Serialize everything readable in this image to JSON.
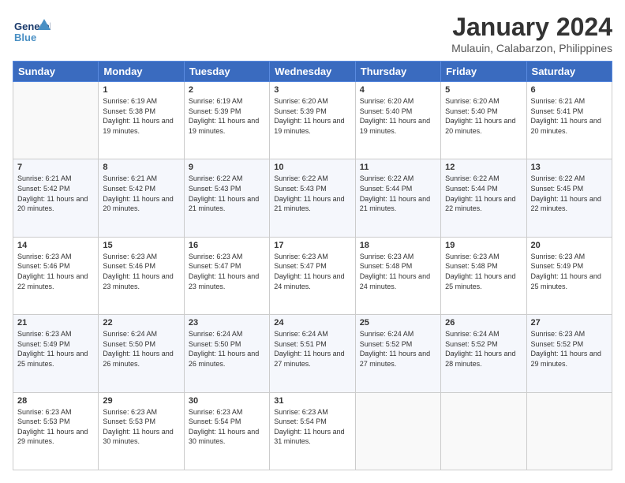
{
  "header": {
    "logo_line1": "General",
    "logo_line2": "Blue",
    "title": "January 2024",
    "subtitle": "Mulauin, Calabarzon, Philippines"
  },
  "days_of_week": [
    "Sunday",
    "Monday",
    "Tuesday",
    "Wednesday",
    "Thursday",
    "Friday",
    "Saturday"
  ],
  "weeks": [
    [
      {
        "day": "",
        "sunrise": "",
        "sunset": "",
        "daylight": ""
      },
      {
        "day": "1",
        "sunrise": "Sunrise: 6:19 AM",
        "sunset": "Sunset: 5:38 PM",
        "daylight": "Daylight: 11 hours and 19 minutes."
      },
      {
        "day": "2",
        "sunrise": "Sunrise: 6:19 AM",
        "sunset": "Sunset: 5:39 PM",
        "daylight": "Daylight: 11 hours and 19 minutes."
      },
      {
        "day": "3",
        "sunrise": "Sunrise: 6:20 AM",
        "sunset": "Sunset: 5:39 PM",
        "daylight": "Daylight: 11 hours and 19 minutes."
      },
      {
        "day": "4",
        "sunrise": "Sunrise: 6:20 AM",
        "sunset": "Sunset: 5:40 PM",
        "daylight": "Daylight: 11 hours and 19 minutes."
      },
      {
        "day": "5",
        "sunrise": "Sunrise: 6:20 AM",
        "sunset": "Sunset: 5:40 PM",
        "daylight": "Daylight: 11 hours and 20 minutes."
      },
      {
        "day": "6",
        "sunrise": "Sunrise: 6:21 AM",
        "sunset": "Sunset: 5:41 PM",
        "daylight": "Daylight: 11 hours and 20 minutes."
      }
    ],
    [
      {
        "day": "7",
        "sunrise": "Sunrise: 6:21 AM",
        "sunset": "Sunset: 5:42 PM",
        "daylight": "Daylight: 11 hours and 20 minutes."
      },
      {
        "day": "8",
        "sunrise": "Sunrise: 6:21 AM",
        "sunset": "Sunset: 5:42 PM",
        "daylight": "Daylight: 11 hours and 20 minutes."
      },
      {
        "day": "9",
        "sunrise": "Sunrise: 6:22 AM",
        "sunset": "Sunset: 5:43 PM",
        "daylight": "Daylight: 11 hours and 21 minutes."
      },
      {
        "day": "10",
        "sunrise": "Sunrise: 6:22 AM",
        "sunset": "Sunset: 5:43 PM",
        "daylight": "Daylight: 11 hours and 21 minutes."
      },
      {
        "day": "11",
        "sunrise": "Sunrise: 6:22 AM",
        "sunset": "Sunset: 5:44 PM",
        "daylight": "Daylight: 11 hours and 21 minutes."
      },
      {
        "day": "12",
        "sunrise": "Sunrise: 6:22 AM",
        "sunset": "Sunset: 5:44 PM",
        "daylight": "Daylight: 11 hours and 22 minutes."
      },
      {
        "day": "13",
        "sunrise": "Sunrise: 6:22 AM",
        "sunset": "Sunset: 5:45 PM",
        "daylight": "Daylight: 11 hours and 22 minutes."
      }
    ],
    [
      {
        "day": "14",
        "sunrise": "Sunrise: 6:23 AM",
        "sunset": "Sunset: 5:46 PM",
        "daylight": "Daylight: 11 hours and 22 minutes."
      },
      {
        "day": "15",
        "sunrise": "Sunrise: 6:23 AM",
        "sunset": "Sunset: 5:46 PM",
        "daylight": "Daylight: 11 hours and 23 minutes."
      },
      {
        "day": "16",
        "sunrise": "Sunrise: 6:23 AM",
        "sunset": "Sunset: 5:47 PM",
        "daylight": "Daylight: 11 hours and 23 minutes."
      },
      {
        "day": "17",
        "sunrise": "Sunrise: 6:23 AM",
        "sunset": "Sunset: 5:47 PM",
        "daylight": "Daylight: 11 hours and 24 minutes."
      },
      {
        "day": "18",
        "sunrise": "Sunrise: 6:23 AM",
        "sunset": "Sunset: 5:48 PM",
        "daylight": "Daylight: 11 hours and 24 minutes."
      },
      {
        "day": "19",
        "sunrise": "Sunrise: 6:23 AM",
        "sunset": "Sunset: 5:48 PM",
        "daylight": "Daylight: 11 hours and 25 minutes."
      },
      {
        "day": "20",
        "sunrise": "Sunrise: 6:23 AM",
        "sunset": "Sunset: 5:49 PM",
        "daylight": "Daylight: 11 hours and 25 minutes."
      }
    ],
    [
      {
        "day": "21",
        "sunrise": "Sunrise: 6:23 AM",
        "sunset": "Sunset: 5:49 PM",
        "daylight": "Daylight: 11 hours and 25 minutes."
      },
      {
        "day": "22",
        "sunrise": "Sunrise: 6:24 AM",
        "sunset": "Sunset: 5:50 PM",
        "daylight": "Daylight: 11 hours and 26 minutes."
      },
      {
        "day": "23",
        "sunrise": "Sunrise: 6:24 AM",
        "sunset": "Sunset: 5:50 PM",
        "daylight": "Daylight: 11 hours and 26 minutes."
      },
      {
        "day": "24",
        "sunrise": "Sunrise: 6:24 AM",
        "sunset": "Sunset: 5:51 PM",
        "daylight": "Daylight: 11 hours and 27 minutes."
      },
      {
        "day": "25",
        "sunrise": "Sunrise: 6:24 AM",
        "sunset": "Sunset: 5:52 PM",
        "daylight": "Daylight: 11 hours and 27 minutes."
      },
      {
        "day": "26",
        "sunrise": "Sunrise: 6:24 AM",
        "sunset": "Sunset: 5:52 PM",
        "daylight": "Daylight: 11 hours and 28 minutes."
      },
      {
        "day": "27",
        "sunrise": "Sunrise: 6:23 AM",
        "sunset": "Sunset: 5:52 PM",
        "daylight": "Daylight: 11 hours and 29 minutes."
      }
    ],
    [
      {
        "day": "28",
        "sunrise": "Sunrise: 6:23 AM",
        "sunset": "Sunset: 5:53 PM",
        "daylight": "Daylight: 11 hours and 29 minutes."
      },
      {
        "day": "29",
        "sunrise": "Sunrise: 6:23 AM",
        "sunset": "Sunset: 5:53 PM",
        "daylight": "Daylight: 11 hours and 30 minutes."
      },
      {
        "day": "30",
        "sunrise": "Sunrise: 6:23 AM",
        "sunset": "Sunset: 5:54 PM",
        "daylight": "Daylight: 11 hours and 30 minutes."
      },
      {
        "day": "31",
        "sunrise": "Sunrise: 6:23 AM",
        "sunset": "Sunset: 5:54 PM",
        "daylight": "Daylight: 11 hours and 31 minutes."
      },
      {
        "day": "",
        "sunrise": "",
        "sunset": "",
        "daylight": ""
      },
      {
        "day": "",
        "sunrise": "",
        "sunset": "",
        "daylight": ""
      },
      {
        "day": "",
        "sunrise": "",
        "sunset": "",
        "daylight": ""
      }
    ]
  ]
}
